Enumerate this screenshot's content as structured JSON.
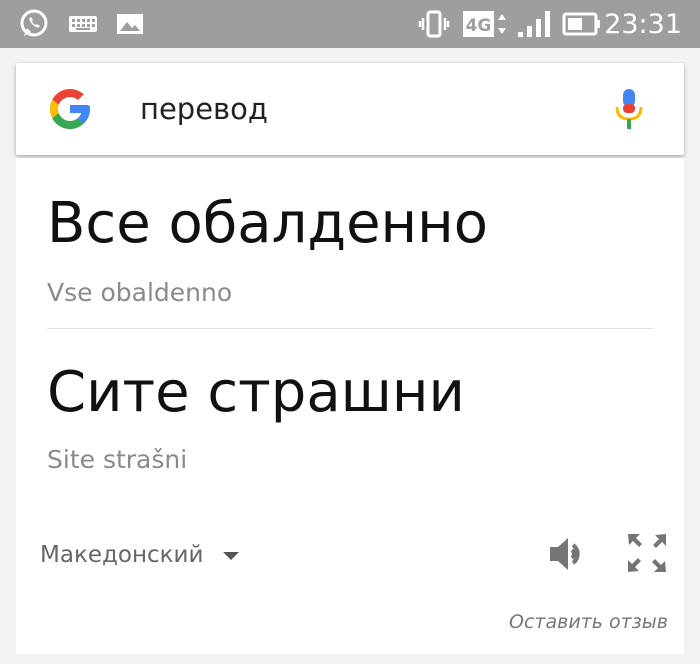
{
  "status_bar": {
    "time": "23:31",
    "network": "4G",
    "icons": [
      "whatsapp-icon",
      "keyboard-icon",
      "image-icon",
      "vibrate-icon",
      "network-4g-icon",
      "signal-icon",
      "battery-icon"
    ]
  },
  "search": {
    "query": "перевод",
    "icons": [
      "google-logo",
      "mic-icon"
    ]
  },
  "results": [
    {
      "text": "Все обалденно",
      "transliteration": "Vse obaldenno"
    },
    {
      "text": "Сите страшни",
      "transliteration": "Site strašni"
    }
  ],
  "language": {
    "selected": "Македонский"
  },
  "feedback_label": "Оставить отзыв",
  "colors": {
    "status_bar": "#9e9e9e",
    "google_blue": "#4285f4",
    "google_red": "#ea4335",
    "google_yellow": "#fbbc05",
    "google_green": "#34a853"
  }
}
